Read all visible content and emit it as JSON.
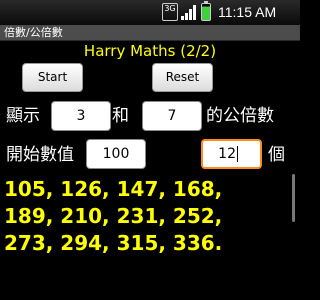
{
  "status_bar": {
    "network": "3G",
    "time": "11:15 AM",
    "icons": [
      "3g-icon",
      "signal-icon",
      "battery-icon"
    ]
  },
  "app": {
    "title": "倍數/公倍數",
    "heading": "Harry Maths (2/2)"
  },
  "buttons": {
    "start": "Start",
    "reset": "Reset"
  },
  "row1": {
    "label_show": "顯示",
    "value_a": "3",
    "label_and": "和",
    "value_b": "7",
    "label_suffix": "的公倍數"
  },
  "row2": {
    "label_start": "開始數值",
    "start_value": "100",
    "count_value": "12",
    "label_count": "個"
  },
  "result_lines": [
    "105, 126, 147, 168,",
    "189, 210, 231, 252,",
    "273, 294, 315, 336."
  ],
  "colors": {
    "accent_text": "#ffff00",
    "focus_border": "#ff8c1a",
    "background": "#000000"
  }
}
